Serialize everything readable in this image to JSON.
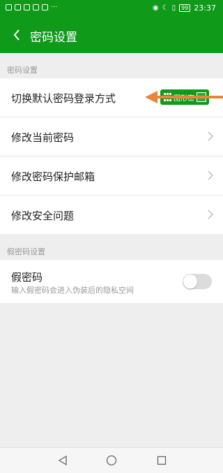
{
  "status_bar": {
    "battery": "99",
    "time": "23:37"
  },
  "app_bar": {
    "title": "密码设置"
  },
  "sections": {
    "password": {
      "label": "密码设置",
      "rows": [
        {
          "label": "切换默认密码登录方式",
          "button": "图形密"
        },
        {
          "label": "修改当前密码"
        },
        {
          "label": "修改密码保护邮箱"
        },
        {
          "label": "修改安全问题"
        }
      ]
    },
    "fake_password": {
      "label": "假密码设置",
      "title": "假密码",
      "subtitle": "输入假密码会进入伪装后的隐私空间",
      "toggle_on": false
    }
  },
  "colors": {
    "brand_green": "#0f9a1a",
    "annotation_arrow": "#e8853a"
  },
  "icons": [
    "back-arrow-icon",
    "chevron-right-icon",
    "pattern-grid-icon",
    "toggle-switch",
    "nav-back-icon",
    "nav-home-icon",
    "nav-recents-icon"
  ]
}
